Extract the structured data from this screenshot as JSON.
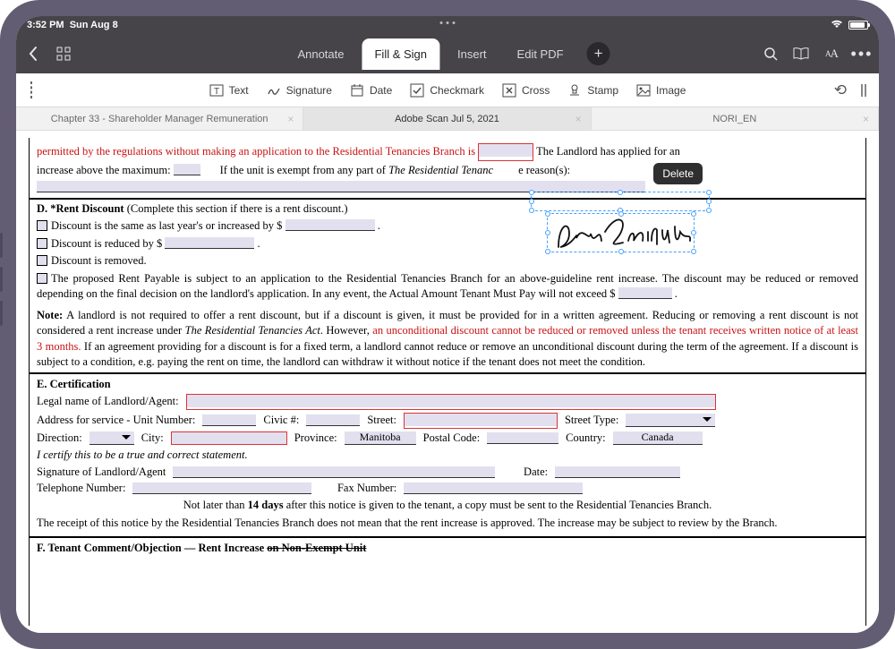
{
  "status": {
    "time": "3:52 PM",
    "date": "Sun Aug 8"
  },
  "topnav": {
    "tabs": {
      "annotate": "Annotate",
      "fillsign": "Fill & Sign",
      "insert": "Insert",
      "edit": "Edit PDF"
    }
  },
  "toolbar": {
    "text": "Text",
    "signature": "Signature",
    "date": "Date",
    "checkmark": "Checkmark",
    "cross": "Cross",
    "stamp": "Stamp",
    "image": "Image"
  },
  "filetabs": {
    "t1": "Chapter 33 - Shareholder Manager Remuneration",
    "t2": "Adobe Scan Jul 5, 2021",
    "t3": "NORI_EN"
  },
  "tooltip": {
    "delete": "Delete"
  },
  "doc": {
    "topred": "permitted by the regulations without making an application to the Residential Tenancies Branch is",
    "topend": "The Landlord has applied for an",
    "line2a": "increase above the maximum:",
    "line2b": "If the unit is exempt from any part of ",
    "line2i": "The Residential Tenanc",
    "line2c": "e reason(s):",
    "dHead": "D.  *Rent Discount ",
    "dSub": "(Complete this section if there is a rent discount.)",
    "d1a": "Discount is the same as last year's or increased by $",
    "d2a": "Discount is reduced by $",
    "d3": "Discount is removed.",
    "d4": "The proposed Rent Payable is subject to an application to the Residential Tenancies Branch for an above-guideline rent increase. The discount may be reduced or removed depending on the final decision on the landlord's application. In any event, the Actual Amount Tenant Must Pay will not exceed $",
    "noteLead": "Note:",
    "noteBody1": " A landlord is not required to offer a rent discount, but if a discount is given, it must be provided for in a written agreement. Reducing or removing a rent discount is not considered a rent increase under ",
    "noteItal": "The Residential Tenancies Act",
    "noteBody2": ". However, ",
    "noteRed": "an unconditional discount cannot be reduced or removed unless the tenant receives written notice of at least 3 months.",
    "noteBody3": " If an agreement providing for a discount is for a fixed term, a landlord cannot reduce or remove an unconditional discount during the term of the agreement. If a discount is subject to a condition, e.g. paying the rent on time, the landlord can withdraw it without notice if the tenant does not meet the condition.",
    "eHead": "E. Certification",
    "legal": "Legal name of Landlord/Agent:",
    "addr": "Address for service - Unit Number:",
    "civic": "Civic #:",
    "street": "Street:",
    "stype": "Street Type:",
    "dir": "Direction:",
    "city": "City:",
    "prov": "Province:",
    "provVal": "Manitoba",
    "postal": "Postal Code:",
    "country": "Country:",
    "countryVal": "Canada",
    "cert": "I certify this to be a true and correct statement.",
    "sigLA": "Signature of Landlord/Agent",
    "dateL": "Date:",
    "tel": "Telephone Number:",
    "fax": "Fax Number:",
    "p1": "Not later than ",
    "p1b": "14 days",
    "p1c": " after this notice is given to the tenant, a copy must be sent to the Residential Tenancies Branch.",
    "p2": "The receipt of this notice by the Residential Tenancies Branch does not mean that the rent increase is approved.  The increase may be subject to review by the Branch.",
    "fHead1": "F.  Tenant Comment/Objection — Rent Increase ",
    "fHead2": "on Non-Exempt Unit"
  }
}
